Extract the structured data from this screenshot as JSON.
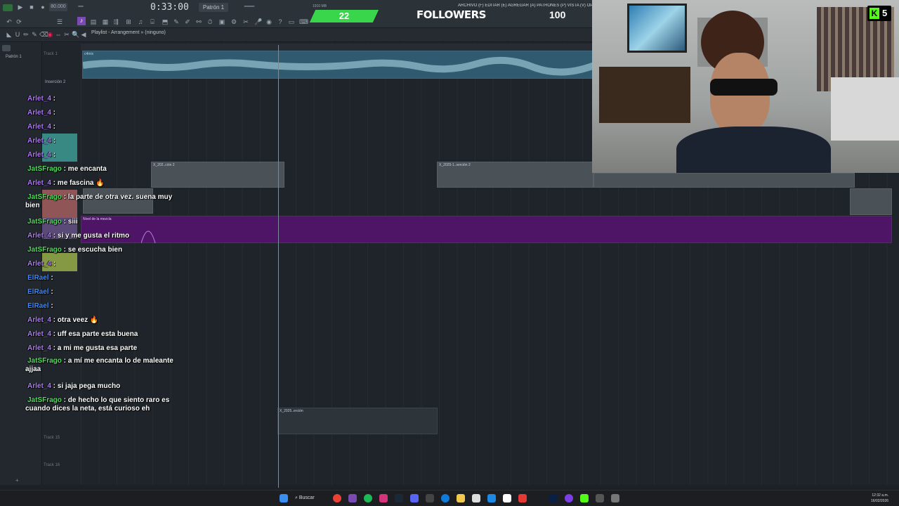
{
  "toolbar": {
    "tempo": "80.000",
    "time": "0:33:00",
    "pattern": "Patrón 1",
    "menu": "ARCHIVO (F)  EDITAR (E)  AGREGAR (A)  PATRONES (P)  VISTA (V)  OPCIONES (",
    "stats": "1910 MB"
  },
  "followers": {
    "current": "22",
    "label": "FOLLOWERS",
    "goal": "100",
    "progress_fraction": 0.22
  },
  "breadcrumb": "Playlist - Arrangement » (ninguno)",
  "rail": {
    "pattern_item": "Patrón 1"
  },
  "tracks": {
    "track1": "Track 1",
    "insert2": "Inserción 2",
    "track15": "Track 15",
    "track16": "Track 16"
  },
  "clips": {
    "top_clip": "c4mix",
    "mid_clip_a": "X_202..ción 2",
    "mid_clip_b": "X_2025-1..serción 2",
    "automation": "Nivel de la mezcla",
    "bottom_clip": "X_2025..erción"
  },
  "chat": {
    "messages": [
      {
        "user": "Arlet_4",
        "color": "#b078ff",
        "text": ""
      },
      {
        "user": "Arlet_4",
        "color": "#b078ff",
        "text": ""
      },
      {
        "user": "Arlet_4",
        "color": "#b078ff",
        "text": ""
      },
      {
        "user": "Arlet_4",
        "color": "#b078ff",
        "text": ""
      },
      {
        "user": "Arlet_4",
        "color": "#b078ff",
        "text": ""
      },
      {
        "user": "JatSFrago",
        "color": "#4ee05a",
        "text": "me encanta"
      },
      {
        "user": "Arlet_4",
        "color": "#b078ff",
        "text": "me fascina 🔥"
      },
      {
        "user": "JatSFrago",
        "color": "#4ee05a",
        "text": "la parte de otra vez. suena muy bien"
      },
      {
        "user": "JatSFrago",
        "color": "#4ee05a",
        "text": "siii"
      },
      {
        "user": "Arlet_4",
        "color": "#b078ff",
        "text": "si y me gusta el ritmo"
      },
      {
        "user": "JatSFrago",
        "color": "#4ee05a",
        "text": "se escucha bien"
      },
      {
        "user": "Arlet_4",
        "color": "#b078ff",
        "text": ""
      },
      {
        "user": "ElRael",
        "color": "#3e8cff",
        "text": ""
      },
      {
        "user": "ElRael",
        "color": "#3e8cff",
        "text": ""
      },
      {
        "user": "ElRael",
        "color": "#3e8cff",
        "text": ""
      },
      {
        "user": "Arlet_4",
        "color": "#b078ff",
        "text": "otra veez 🔥"
      },
      {
        "user": "Arlet_4",
        "color": "#b078ff",
        "text": "uff esa parte esta buena"
      },
      {
        "user": "Arlet_4",
        "color": "#b078ff",
        "text": "a mi me gusta esa parte"
      },
      {
        "user": "JatSFrago",
        "color": "#4ee05a",
        "text": "a mí me encanta lo de maleante ajjaa"
      },
      {
        "user": "Arlet_4",
        "color": "#b078ff",
        "text": "si jaja pega mucho"
      },
      {
        "user": "JatSFrago",
        "color": "#4ee05a",
        "text": "de hecho lo que siento raro es cuando dices la neta, está curioso eh"
      }
    ]
  },
  "webcam": {
    "badge_letter": "K",
    "badge_count": "5"
  },
  "taskbar": {
    "search": "Buscar",
    "time": "12:32 a.m.",
    "date": "16/02/2026"
  }
}
